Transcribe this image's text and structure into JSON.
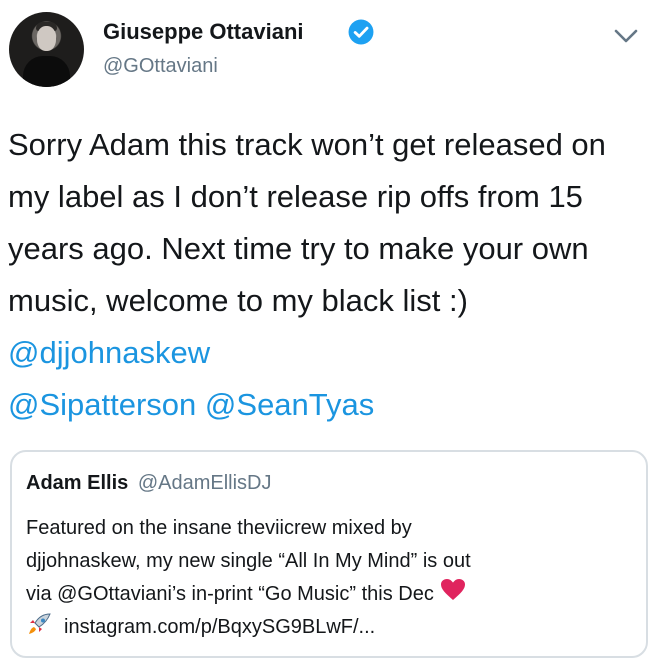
{
  "tweet": {
    "author": {
      "display_name": "Giuseppe Ottaviani",
      "handle": "@GOttaviani",
      "verified": true
    },
    "text_plain_1": "Sorry Adam this track won’t get released on my label as I don’t release rip offs from 15 years ago. Next time try to make your own music, welcome to my black list :) ",
    "mentions": [
      "@djjohnaskew",
      "@Sipatterson",
      "@SeanTyas"
    ],
    "quoted_tweet": {
      "display_name": "Adam Ellis",
      "handle": "@AdamEllisDJ",
      "lines": [
        "Featured on the insane theviicrew mixed by",
        "djjohnaskew, my new single “All In My Mind” is out",
        "via @GOttaviani’s in-print “Go Music” this Dec",
        "instagram.com/p/BqxySG9BLwF/..."
      ]
    }
  },
  "colors": {
    "text": "#14171a",
    "muted": "#657786",
    "link": "#1b95e0",
    "verified_badge": "#1da1f2",
    "border": "#d8dee3",
    "heart": "#e0245e"
  },
  "icons": [
    "verified-badge-icon",
    "chevron-down-icon",
    "red-heart-icon",
    "rocket-icon"
  ]
}
